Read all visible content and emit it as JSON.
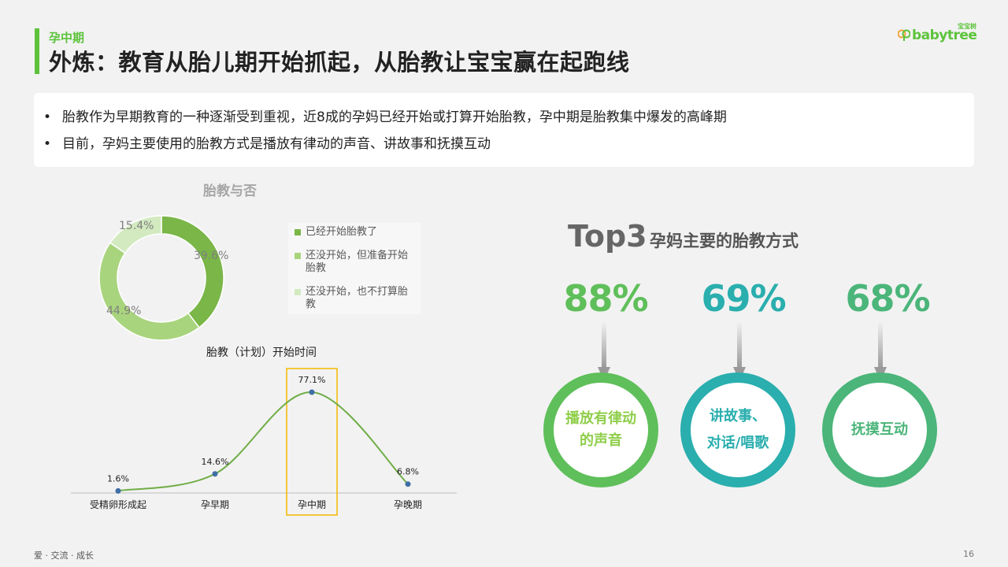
{
  "header": {
    "subtitle": "孕中期",
    "title": "外炼：教育从胎儿期开始抓起，从胎教让宝宝赢在起跑线",
    "logo_text": "babytree",
    "logo_small": "宝宝树"
  },
  "bullets": [
    "胎教作为早期教育的一种逐渐受到重视，近8成的孕妈已经开始或打算开始胎教，孕中期是胎教集中爆发的高峰期",
    "目前，孕妈主要使用的胎教方式是播放有律动的声音、讲故事和抚摸互动"
  ],
  "bullet_symbol": "•",
  "chart_data": [
    {
      "type": "pie",
      "title": "胎教与否",
      "categories": [
        "已经开始胎教了",
        "还没开始，但准备开始胎教",
        "还没开始，也不打算胎教"
      ],
      "values": [
        39.6,
        44.9,
        15.4
      ],
      "labels": [
        "39.6%",
        "44.9%",
        "15.4%"
      ],
      "colors": [
        "#7ab648",
        "#a9d47e",
        "#d3eac0"
      ],
      "legend_position": "right"
    },
    {
      "type": "line",
      "title": "胎教（计划）开始时间",
      "categories": [
        "受精卵形成起",
        "孕早期",
        "孕中期",
        "孕晚期"
      ],
      "values": [
        1.6,
        14.6,
        77.1,
        6.8
      ],
      "labels": [
        "1.6%",
        "14.6%",
        "77.1%",
        "6.8%"
      ],
      "highlight": "孕中期",
      "line_color": "#70ad47",
      "point_color": "#3f6ea6",
      "highlight_color": "#f5b800"
    }
  ],
  "top3": {
    "label": "Top3",
    "subtitle": "孕妈主要的胎教方式",
    "items": [
      {
        "pct": "88%",
        "lines": [
          "播放有律动",
          "的声音"
        ],
        "color": "#5fbf5a",
        "text_color": "#8fce4a"
      },
      {
        "pct": "69%",
        "lines": [
          "讲故事、",
          "对话/唱歌"
        ],
        "color": "#2aaeae",
        "text_color": "#2aaeae"
      },
      {
        "pct": "68%",
        "lines": [
          "抚摸互动"
        ],
        "color": "#4bb57a",
        "text_color": "#4bb57a"
      }
    ]
  },
  "footer": {
    "left": "爱 · 交流 · 成长",
    "page": "16"
  }
}
